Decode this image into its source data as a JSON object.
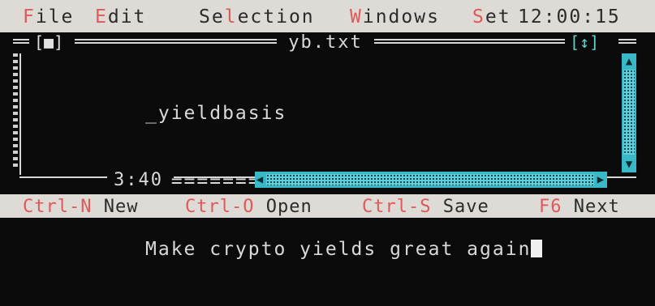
{
  "menu": {
    "file": {
      "hot": "F",
      "rest": "ile"
    },
    "edit": {
      "hot": "E",
      "rest": "dit"
    },
    "selection": {
      "pre": "Se",
      "hot": "l",
      "rest": "ection"
    },
    "windows": {
      "hot": "W",
      "rest": "indows"
    },
    "set": {
      "hot": "S",
      "rest": "et"
    },
    "clock": "12:00:15"
  },
  "window": {
    "title": "yb.txt",
    "close_box": "[■]",
    "zoom_box": "[↕]"
  },
  "editor": {
    "lines": [
      "_yieldbasis",
      "===================",
      "Make crypto yields great again"
    ]
  },
  "cursor_position": "3:40",
  "statusbar": [
    {
      "key": "Ctrl-N",
      "label": "New"
    },
    {
      "key": "Ctrl-O",
      "label": "Open"
    },
    {
      "key": "Ctrl-S",
      "label": "Save"
    },
    {
      "key": "F6",
      "label": "Next"
    }
  ],
  "colors": {
    "menu_bg": "#dedad6",
    "accent": "#39b8c8",
    "hotkey": "#e05858",
    "screen_bg": "#0b0b0b"
  }
}
